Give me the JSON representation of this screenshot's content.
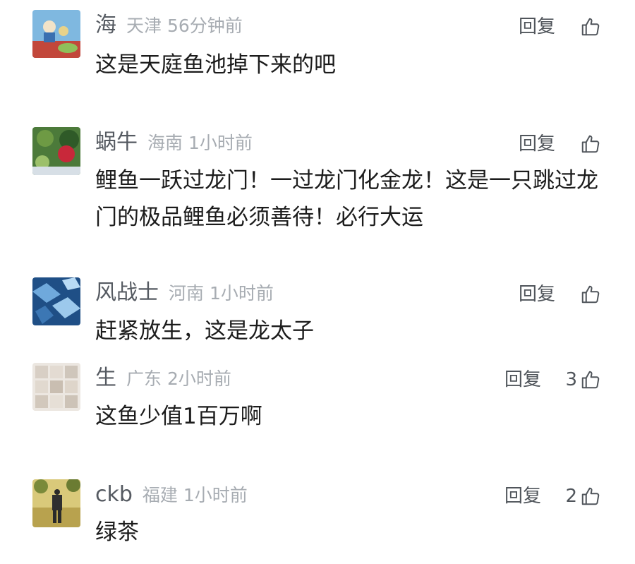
{
  "comments": [
    {
      "user": "海",
      "location": "天津",
      "time": "56分钟前",
      "reply": "回复",
      "likes": "",
      "text": "这是天庭鱼池掉下来的吧"
    },
    {
      "user": "蜗牛",
      "location": "海南",
      "time": "1小时前",
      "reply": "回复",
      "likes": "",
      "text": "鲤鱼一跃过龙门！一过龙门化金龙！这是一只跳过龙门的极品鲤鱼必须善待！必行大运"
    },
    {
      "user": "风战士",
      "location": "河南",
      "time": "1小时前",
      "reply": "回复",
      "likes": "",
      "text": "赶紧放生，这是龙太子"
    },
    {
      "user": "生",
      "location": "广东",
      "time": "2小时前",
      "reply": "回复",
      "likes": "3",
      "text": "这鱼少值1百万啊"
    },
    {
      "user": "ckb",
      "location": "福建",
      "time": "1小时前",
      "reply": "回复",
      "likes": "2",
      "text": "绿茶"
    }
  ],
  "icons": {
    "like": "thumbs-up-icon"
  }
}
